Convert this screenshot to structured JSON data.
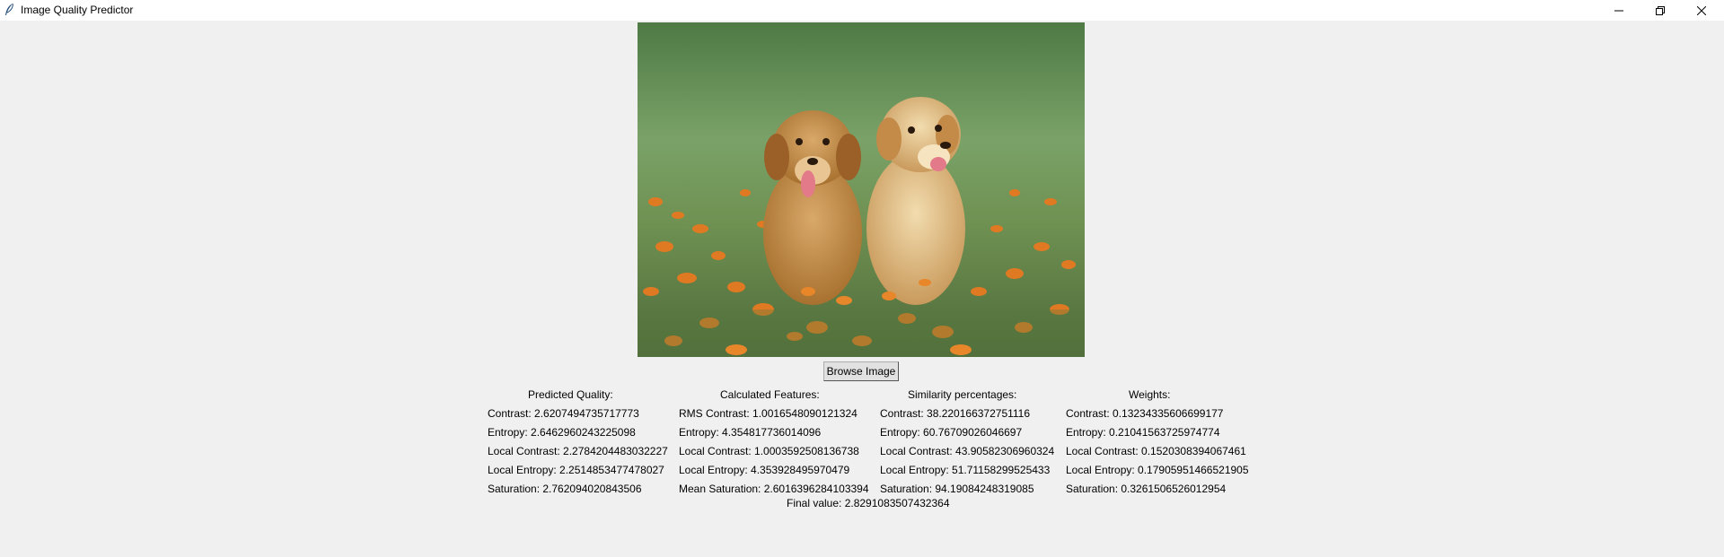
{
  "window": {
    "title": "Image Quality Predictor",
    "controls": [
      "minimize",
      "restore",
      "close"
    ]
  },
  "image": {
    "description_icon": "photo"
  },
  "browse_button": {
    "label": "Browse Image"
  },
  "predicted": {
    "heading": "Predicted Quality:",
    "rows": [
      "Contrast: 2.6207494735717773",
      "Entropy: 2.6462960243225098",
      "Local Contrast: 2.2784204483032227",
      "Local Entropy: 2.2514853477478027",
      "Saturation: 2.762094020843506"
    ]
  },
  "features": {
    "heading": "Calculated Features:",
    "rows": [
      "RMS Contrast: 1.0016548090121324",
      "Entropy: 4.354817736014096",
      "Local Contrast: 1.0003592508136738",
      "Local Entropy: 4.353928495970479",
      "Mean Saturation: 2.6016396284103394"
    ]
  },
  "similarity": {
    "heading": "Similarity percentages:",
    "rows": [
      "Contrast: 38.220166372751116",
      "Entropy: 60.76709026046697",
      "Local Contrast: 43.90582306960324",
      "Local Entropy: 51.71158299525433",
      "Saturation: 94.19084248319085"
    ]
  },
  "weights": {
    "heading": "Weights:",
    "rows": [
      "Contrast: 0.13234335606699177",
      "Entropy: 0.21041563725974774",
      "Local Contrast: 0.1520308394067461",
      "Local Entropy: 0.17905951466521905",
      "Saturation: 0.3261506526012954"
    ]
  },
  "final": {
    "text": "Final value: 2.8291083507432364"
  },
  "colors": {
    "background": "#f0f0f0",
    "titlebar": "#ffffff"
  }
}
